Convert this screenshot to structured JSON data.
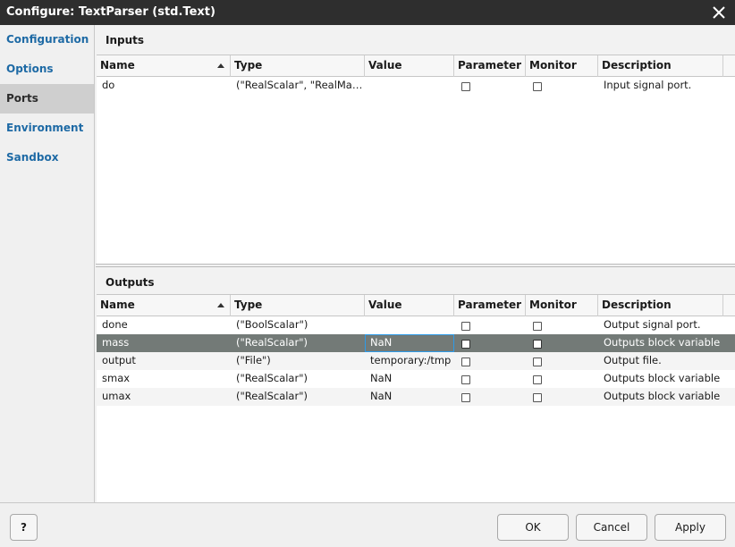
{
  "window": {
    "title": "Configure: TextParser (std.Text)"
  },
  "sidebar": {
    "items": [
      {
        "label": "Configuration"
      },
      {
        "label": "Options"
      },
      {
        "label": "Ports",
        "active": true
      },
      {
        "label": "Environment"
      },
      {
        "label": "Sandbox"
      }
    ]
  },
  "columns": [
    "Name",
    "Type",
    "Value",
    "Parameter",
    "Monitor",
    "Description"
  ],
  "inputs": {
    "title": "Inputs",
    "rows": [
      {
        "name": "do",
        "type": "(\"RealScalar\", \"RealMatrix\")",
        "value": "",
        "parameter": false,
        "monitor": false,
        "description": "Input signal port."
      }
    ]
  },
  "outputs": {
    "title": "Outputs",
    "rows": [
      {
        "name": "done",
        "type": "(\"BoolScalar\")",
        "value": "",
        "parameter": false,
        "monitor": false,
        "description": "Output signal port."
      },
      {
        "name": "mass",
        "type": "(\"RealScalar\")",
        "value": "NaN",
        "parameter": false,
        "monitor": false,
        "description": "Outputs block variable",
        "selected": true
      },
      {
        "name": "output",
        "type": "(\"File\")",
        "value": "temporary:/tmp",
        "parameter": false,
        "monitor": false,
        "description": "Output file."
      },
      {
        "name": "smax",
        "type": "(\"RealScalar\")",
        "value": "NaN",
        "parameter": false,
        "monitor": false,
        "description": "Outputs block variable"
      },
      {
        "name": "umax",
        "type": "(\"RealScalar\")",
        "value": "NaN",
        "parameter": false,
        "monitor": false,
        "description": "Outputs block variable"
      }
    ]
  },
  "footer": {
    "help_label": "?",
    "ok_label": "OK",
    "cancel_label": "Cancel",
    "apply_label": "Apply"
  },
  "colors": {
    "titlebar": "#2e2e2e",
    "nav_link": "#1e6aa5",
    "selected_row": "#737a77",
    "focus_border": "#2d9be8"
  },
  "icons": {
    "close": "close-icon",
    "sort": "sort-ascending-icon"
  }
}
